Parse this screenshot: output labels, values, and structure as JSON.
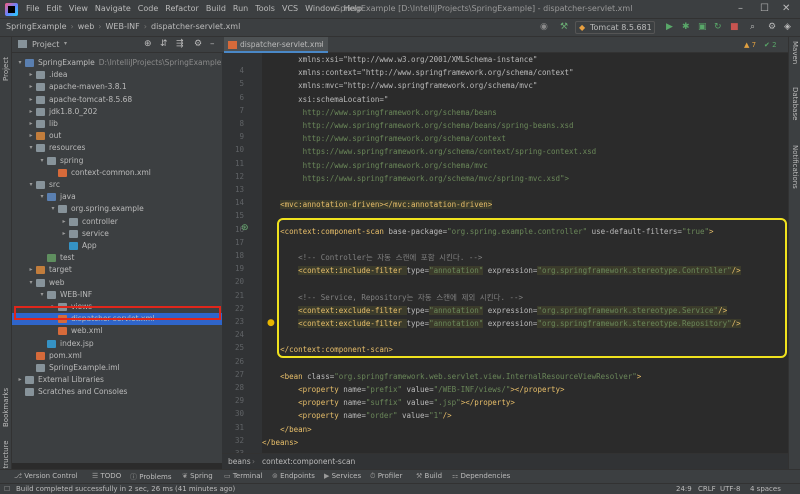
{
  "menubar": {
    "items": [
      "File",
      "Edit",
      "View",
      "Navigate",
      "Code",
      "Refactor",
      "Build",
      "Run",
      "Tools",
      "VCS",
      "Window",
      "Help"
    ],
    "window_title": "SpringExample [D:\\IntelliJProjects\\SpringExample] - dispatcher-servlet.xml"
  },
  "navbar": {
    "crumbs": [
      "SpringExample",
      "web",
      "WEB-INF",
      "dispatcher-servlet.xml"
    ],
    "run_config": "Tomcat 8.5.681"
  },
  "left_strip": {
    "project": "Project",
    "bookmarks": "Bookmarks",
    "structure": "Structure"
  },
  "right_strip": {
    "maven": "Maven",
    "database": "Database",
    "notifications": "Notifications"
  },
  "project_panel": {
    "title": "Project",
    "tree": [
      {
        "label": "SpringExample",
        "sub": "D:\\IntelliJProjects\\SpringExample",
        "depth": 0,
        "arrow": "▾",
        "icon": "folder-b"
      },
      {
        "label": ".idea",
        "depth": 1,
        "arrow": "▸",
        "icon": "folder"
      },
      {
        "label": "apache-maven-3.8.1",
        "depth": 1,
        "arrow": "▸",
        "icon": "folder"
      },
      {
        "label": "apache-tomcat-8.5.68",
        "depth": 1,
        "arrow": "▸",
        "icon": "folder"
      },
      {
        "label": "jdk1.8.0_202",
        "depth": 1,
        "arrow": "▸",
        "icon": "folder"
      },
      {
        "label": "lib",
        "depth": 1,
        "arrow": "▸",
        "icon": "folder"
      },
      {
        "label": "out",
        "depth": 1,
        "arrow": "▸",
        "icon": "folder-o"
      },
      {
        "label": "resources",
        "depth": 1,
        "arrow": "▾",
        "icon": "folder"
      },
      {
        "label": "spring",
        "depth": 2,
        "arrow": "▾",
        "icon": "folder"
      },
      {
        "label": "context-common.xml",
        "depth": 3,
        "arrow": "",
        "icon": "file-x"
      },
      {
        "label": "src",
        "depth": 1,
        "arrow": "▾",
        "icon": "folder"
      },
      {
        "label": "java",
        "depth": 2,
        "arrow": "▾",
        "icon": "folder-b"
      },
      {
        "label": "org.spring.example",
        "depth": 3,
        "arrow": "▾",
        "icon": "folder"
      },
      {
        "label": "controller",
        "depth": 4,
        "arrow": "▸",
        "icon": "folder"
      },
      {
        "label": "service",
        "depth": 4,
        "arrow": "▸",
        "icon": "folder"
      },
      {
        "label": "App",
        "depth": 4,
        "arrow": "",
        "icon": "file-c"
      },
      {
        "label": "test",
        "depth": 2,
        "arrow": "",
        "icon": "folder-g"
      },
      {
        "label": "target",
        "depth": 1,
        "arrow": "▸",
        "icon": "folder-o"
      },
      {
        "label": "web",
        "depth": 1,
        "arrow": "▾",
        "icon": "folder"
      },
      {
        "label": "WEB-INF",
        "depth": 2,
        "arrow": "▾",
        "icon": "folder"
      },
      {
        "label": "views",
        "depth": 3,
        "arrow": "▸",
        "icon": "folder"
      },
      {
        "label": "dispatcher-servlet.xml",
        "depth": 3,
        "arrow": "",
        "icon": "file-x",
        "selected": true
      },
      {
        "label": "web.xml",
        "depth": 3,
        "arrow": "",
        "icon": "file-x"
      },
      {
        "label": "index.jsp",
        "depth": 2,
        "arrow": "",
        "icon": "file-j"
      },
      {
        "label": "pom.xml",
        "depth": 1,
        "arrow": "",
        "icon": "file-x"
      },
      {
        "label": "SpringExample.iml",
        "depth": 1,
        "arrow": "",
        "icon": "folder"
      },
      {
        "label": "External Libraries",
        "depth": 0,
        "arrow": "▸",
        "icon": "folder"
      },
      {
        "label": "Scratches and Consoles",
        "depth": 0,
        "arrow": "",
        "icon": "folder"
      }
    ]
  },
  "editor": {
    "tab": "dispatcher-servlet.xml",
    "warnings": "7",
    "checks": "2",
    "lines": [
      {
        "n": "",
        "segs": [
          [
            "        xmlns:xsi=\"http://www.w3.org/2001/XMLSchema-instance\"",
            "attr"
          ]
        ]
      },
      {
        "n": "4",
        "segs": [
          [
            "        xmlns:context=\"http://www.springframework.org/schema/context\"",
            "attr"
          ]
        ]
      },
      {
        "n": "5",
        "segs": [
          [
            "        xmlns:mvc=\"http://www.springframework.org/schema/mvc\"",
            "attr"
          ]
        ]
      },
      {
        "n": "6",
        "segs": [
          [
            "        xsi:schemaLocation=\"",
            "attr"
          ]
        ]
      },
      {
        "n": "7",
        "segs": [
          [
            "         http://www.springframework.org/schema/beans",
            "val"
          ]
        ]
      },
      {
        "n": "8",
        "segs": [
          [
            "         http://www.springframework.org/schema/beans/spring-beans.xsd",
            "val"
          ]
        ]
      },
      {
        "n": "9",
        "segs": [
          [
            "         http://www.springframework.org/schema/context",
            "val"
          ]
        ]
      },
      {
        "n": "10",
        "segs": [
          [
            "         https://www.springframework.org/schema/context/spring-context.xsd",
            "val"
          ]
        ]
      },
      {
        "n": "11",
        "segs": [
          [
            "         http://www.springframework.org/schema/mvc",
            "val"
          ]
        ]
      },
      {
        "n": "12",
        "segs": [
          [
            "         https://www.springframework.org/schema/mvc/spring-mvc.xsd\">",
            "val"
          ]
        ]
      },
      {
        "n": "13",
        "segs": [
          [
            "",
            "attr"
          ]
        ]
      },
      {
        "n": "14",
        "segs": [
          [
            "    ",
            "attr"
          ],
          [
            "<mvc:annotation-driven></mvc:annotation-driven>",
            "tag"
          ]
        ]
      },
      {
        "n": "15",
        "segs": [
          [
            "",
            "attr"
          ]
        ]
      },
      {
        "n": "16",
        "segs": [
          [
            "    ",
            "attr"
          ],
          [
            "<context:component-scan ",
            "tag"
          ],
          [
            "base-package=",
            "attr"
          ],
          [
            "\"org.spring.example.controller\"",
            "val"
          ],
          [
            " use-default-filters=",
            "attr"
          ],
          [
            "\"true\"",
            "val"
          ],
          [
            ">",
            "tag"
          ]
        ]
      },
      {
        "n": "17",
        "segs": [
          [
            "",
            "attr"
          ]
        ]
      },
      {
        "n": "18",
        "segs": [
          [
            "        <!-- Controller는 자동 스캔에 포함 시킨다. -->",
            "cmt"
          ]
        ]
      },
      {
        "n": "19",
        "segs": [
          [
            "        ",
            "attr"
          ],
          [
            "<context:include-filter ",
            "tag"
          ],
          [
            "type=",
            "attr"
          ],
          [
            "\"annotation\"",
            "val"
          ],
          [
            " expression=",
            "attr"
          ],
          [
            "\"org.springframework.stereotype.Controller\"",
            "val"
          ],
          [
            "/>",
            "tag"
          ]
        ]
      },
      {
        "n": "20",
        "segs": [
          [
            "",
            "attr"
          ]
        ]
      },
      {
        "n": "21",
        "segs": [
          [
            "        <!-- Service, Repository는 자동 스캔에 제외 시킨다. -->",
            "cmt"
          ]
        ]
      },
      {
        "n": "22",
        "segs": [
          [
            "        ",
            "attr"
          ],
          [
            "<context:exclude-filter ",
            "tag"
          ],
          [
            "type=",
            "attr"
          ],
          [
            "\"annotation\"",
            "val"
          ],
          [
            " expression=",
            "attr"
          ],
          [
            "\"org.springframework.stereotype.Service\"",
            "val"
          ],
          [
            "/>",
            "tag"
          ]
        ]
      },
      {
        "n": "23",
        "segs": [
          [
            "        ",
            "attr"
          ],
          [
            "<context:exclude-filter ",
            "tag"
          ],
          [
            "type=",
            "attr"
          ],
          [
            "\"annotation\"",
            "val"
          ],
          [
            " expression=",
            "attr"
          ],
          [
            "\"org.springframework.stereotype.Repository\"",
            "val"
          ],
          [
            "/>",
            "tag"
          ]
        ]
      },
      {
        "n": "24",
        "segs": [
          [
            "",
            "attr"
          ]
        ]
      },
      {
        "n": "25",
        "segs": [
          [
            "    ",
            "attr"
          ],
          [
            "</context:component-scan>",
            "tag"
          ]
        ]
      },
      {
        "n": "26",
        "segs": [
          [
            "",
            "attr"
          ]
        ]
      },
      {
        "n": "27",
        "segs": [
          [
            "    ",
            "attr"
          ],
          [
            "<bean ",
            "tag"
          ],
          [
            "class=",
            "attr"
          ],
          [
            "\"org.springframework.web.servlet.view.InternalResourceViewResolver\"",
            "val"
          ],
          [
            ">",
            "tag"
          ]
        ]
      },
      {
        "n": "28",
        "segs": [
          [
            "        ",
            "attr"
          ],
          [
            "<property ",
            "tag"
          ],
          [
            "name=",
            "attr"
          ],
          [
            "\"prefix\"",
            "val"
          ],
          [
            " value=",
            "attr"
          ],
          [
            "\"/WEB-INF/views/\"",
            "val"
          ],
          [
            "></property>",
            "tag"
          ]
        ]
      },
      {
        "n": "29",
        "segs": [
          [
            "        ",
            "attr"
          ],
          [
            "<property ",
            "tag"
          ],
          [
            "name=",
            "attr"
          ],
          [
            "\"suffix\"",
            "val"
          ],
          [
            " value=",
            "attr"
          ],
          [
            "\".jsp\"",
            "val"
          ],
          [
            "></property>",
            "tag"
          ]
        ]
      },
      {
        "n": "30",
        "segs": [
          [
            "        ",
            "attr"
          ],
          [
            "<property ",
            "tag"
          ],
          [
            "name=",
            "attr"
          ],
          [
            "\"order\"",
            "val"
          ],
          [
            " value=",
            "attr"
          ],
          [
            "\"1\"",
            "val"
          ],
          [
            "/>",
            "tag"
          ]
        ]
      },
      {
        "n": "31",
        "segs": [
          [
            "    ",
            "attr"
          ],
          [
            "</bean>",
            "tag"
          ]
        ]
      },
      {
        "n": "32",
        "segs": [
          [
            "</beans>",
            "tag"
          ]
        ]
      },
      {
        "n": "33",
        "segs": [
          [
            "",
            "attr"
          ]
        ]
      }
    ],
    "breadcrumb": [
      "beans",
      "context:component-scan"
    ]
  },
  "bottom_toolbar": [
    "Version Control",
    "TODO",
    "Problems",
    "Spring",
    "Terminal",
    "Endpoints",
    "Services",
    "Profiler",
    "Build",
    "Dependencies"
  ],
  "status": {
    "message": "Build completed successfully in 2 sec, 26 ms (41 minutes ago)",
    "position": "24:9",
    "line_sep": "CRLF",
    "encoding": "UTF-8",
    "indent": "4 spaces"
  }
}
